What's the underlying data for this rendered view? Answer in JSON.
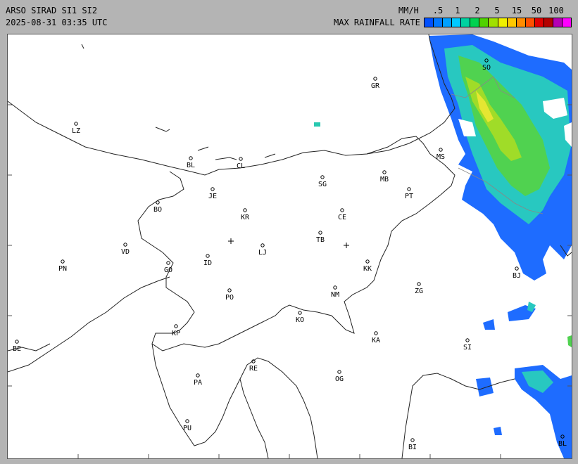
{
  "header": {
    "title": "ARSO SIRAD SI1 SI2",
    "timestamp": "2025-08-31 03:35 UTC",
    "units": "MM/H",
    "scale_label": "MAX RAINFALL RATE"
  },
  "legend": {
    "ticks": [
      ".5",
      "1",
      "2",
      "5",
      "15",
      "50",
      "100"
    ],
    "colors": [
      "#0050ff",
      "#0078ff",
      "#00a0ff",
      "#00c8ff",
      "#00d2a0",
      "#00d250",
      "#50d200",
      "#a0e000",
      "#f0f000",
      "#ffc800",
      "#ff8c00",
      "#ff5000",
      "#e00000",
      "#b40000",
      "#b400b4",
      "#ff00ff"
    ]
  },
  "map": {
    "cities": [
      {
        "code": "GR"
      },
      {
        "code": "SO"
      },
      {
        "code": "LZ"
      },
      {
        "code": "BL"
      },
      {
        "code": "CL"
      },
      {
        "code": "MS"
      },
      {
        "code": "MB"
      },
      {
        "code": "SG"
      },
      {
        "code": "JE"
      },
      {
        "code": "PT"
      },
      {
        "code": "BO"
      },
      {
        "code": "KR"
      },
      {
        "code": "CE"
      },
      {
        "code": "TB"
      },
      {
        "code": "VD"
      },
      {
        "code": "LJ"
      },
      {
        "code": "PN"
      },
      {
        "code": "ID"
      },
      {
        "code": "GO"
      },
      {
        "code": "KK"
      },
      {
        "code": "BJ"
      },
      {
        "code": "PO"
      },
      {
        "code": "NM"
      },
      {
        "code": "ZG"
      },
      {
        "code": "KO"
      },
      {
        "code": "KP"
      },
      {
        "code": "KA"
      },
      {
        "code": "SI"
      },
      {
        "code": "BE"
      },
      {
        "code": "RE"
      },
      {
        "code": "PA"
      },
      {
        "code": "OG"
      },
      {
        "code": "PU"
      },
      {
        "code": "BI"
      },
      {
        "code": "BL"
      }
    ]
  }
}
